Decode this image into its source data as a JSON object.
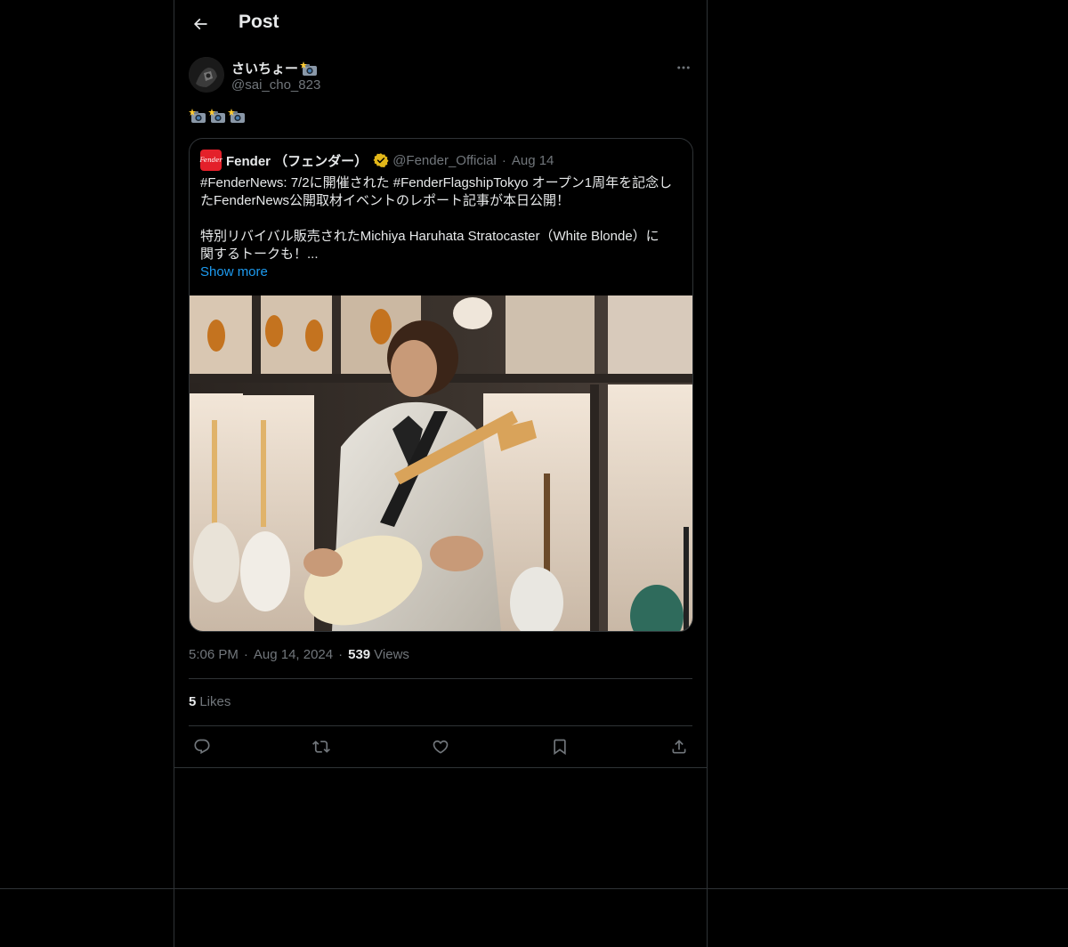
{
  "header": {
    "title": "Post",
    "back_icon": "arrow-left-icon"
  },
  "author": {
    "name": "さいちょー",
    "name_emoji": "camera-flash-icon",
    "handle": "@sai_cho_823",
    "more_icon": "more-horizontal-icon"
  },
  "post": {
    "text_emojis": [
      "camera-flash-icon",
      "camera-flash-icon",
      "camera-flash-icon"
    ]
  },
  "quote": {
    "name": "Fender （フェンダー）",
    "logo_text": "Fender",
    "verified_icon": "verified-gold-badge-icon",
    "handle": "@Fender_Official",
    "dot": "·",
    "date": "Aug 14",
    "lines": [
      "#FenderNews: 7/2に開催された #FenderFlagshipTokyo オープン1周年を記念し",
      "たFenderNews公開取材イベントのレポート記事が本日公開！",
      "特別リバイバル販売されたMichiya Haruhata Stratocaster（White Blonde）に",
      "関するトークも！..."
    ],
    "show_more": "Show more"
  },
  "meta": {
    "time": "5:06 PM",
    "sep1": "·",
    "date": "Aug 14, 2024",
    "sep2": "·",
    "views_count": "539",
    "views_label": "Views"
  },
  "likes": {
    "count": "5",
    "label": "Likes"
  },
  "actions": {
    "reply_icon": "reply-icon",
    "repost_icon": "repost-icon",
    "like_icon": "heart-icon",
    "bookmark_icon": "bookmark-icon",
    "share_icon": "share-icon"
  },
  "colors": {
    "background": "#000000",
    "border": "#2f3336",
    "text": "#e7e9ea",
    "muted": "#71767b",
    "link": "#1d9bf0",
    "fender_red": "#e4202a",
    "verified_gold": "#e2b719"
  }
}
